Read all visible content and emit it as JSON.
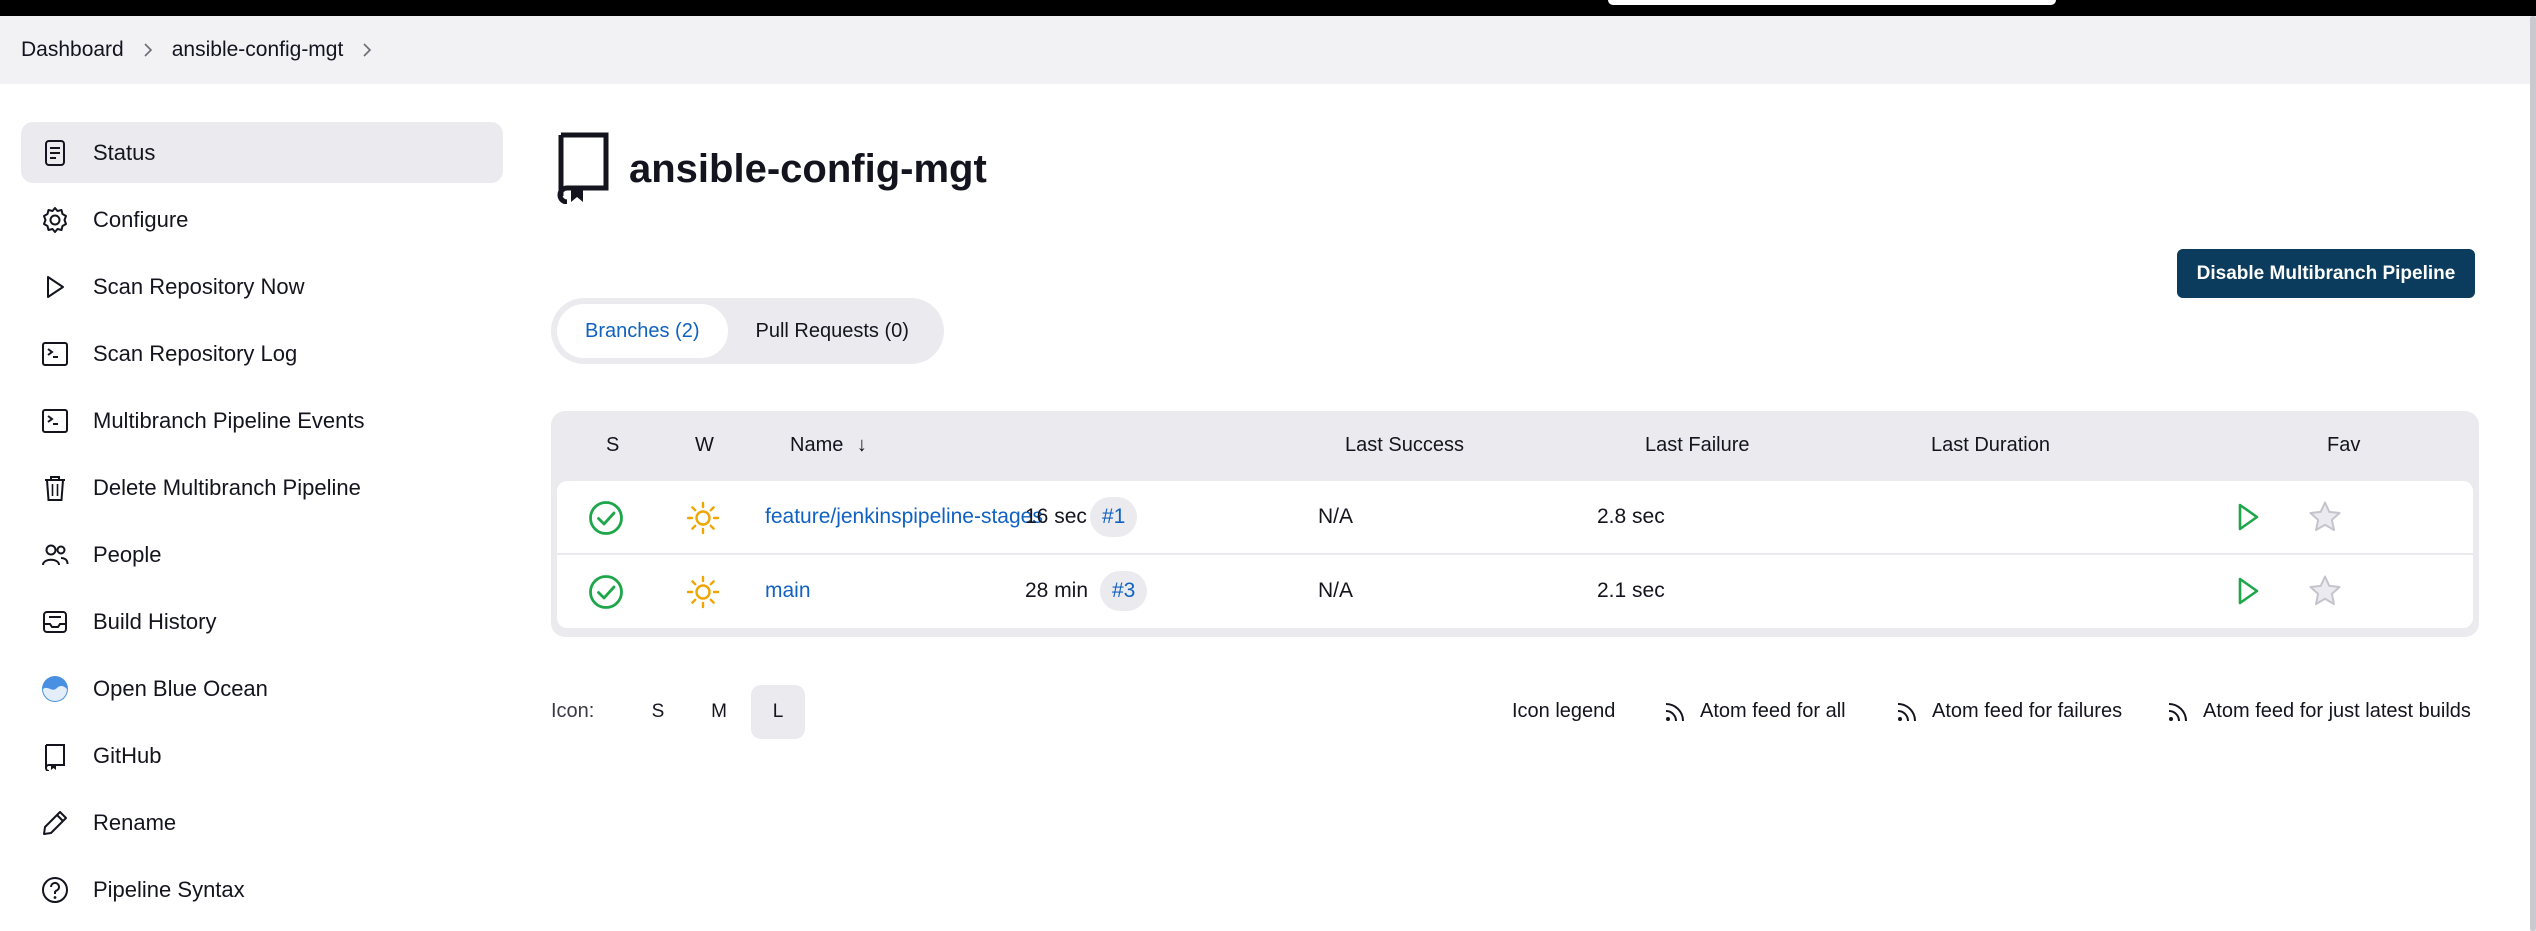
{
  "breadcrumb": {
    "items": [
      {
        "label": "Dashboard"
      },
      {
        "label": "ansible-config-mgt"
      }
    ]
  },
  "sidebar": {
    "items": [
      {
        "label": "Status",
        "icon": "status-document-icon",
        "active": true
      },
      {
        "label": "Configure",
        "icon": "gear-icon"
      },
      {
        "label": "Scan Repository Now",
        "icon": "play-icon"
      },
      {
        "label": "Scan Repository Log",
        "icon": "terminal-icon"
      },
      {
        "label": "Multibranch Pipeline Events",
        "icon": "terminal-icon"
      },
      {
        "label": "Delete Multibranch Pipeline",
        "icon": "trash-icon"
      },
      {
        "label": "People",
        "icon": "people-icon"
      },
      {
        "label": "Build History",
        "icon": "inbox-icon"
      },
      {
        "label": "Open Blue Ocean",
        "icon": "blue-ocean-icon"
      },
      {
        "label": "GitHub",
        "icon": "repository-icon"
      },
      {
        "label": "Rename",
        "icon": "pencil-icon"
      },
      {
        "label": "Pipeline Syntax",
        "icon": "help-circle-icon"
      }
    ]
  },
  "page": {
    "title": "ansible-config-mgt",
    "title_icon": "repository-icon",
    "disable_button": "Disable Multibranch Pipeline"
  },
  "tabs": [
    {
      "label": "Branches (2)",
      "active": true
    },
    {
      "label": "Pull Requests (0)",
      "active": false
    }
  ],
  "table": {
    "headers": {
      "s": "S",
      "w": "W",
      "name": "Name",
      "sort_indicator": "↓",
      "last_success": "Last Success",
      "last_failure": "Last Failure",
      "last_duration": "Last Duration",
      "fav": "Fav"
    },
    "rows": [
      {
        "status": "success",
        "weather": "sunny",
        "name": "feature/jenkinspipeline-stages",
        "last_success": "16 sec",
        "build": "#1",
        "last_failure": "N/A",
        "last_duration": "2.8 sec"
      },
      {
        "status": "success",
        "weather": "sunny",
        "name": "main",
        "last_success": "28 min",
        "build": "#3",
        "last_failure": "N/A",
        "last_duration": "2.1 sec"
      }
    ]
  },
  "footer": {
    "icon_label": "Icon:",
    "sizes": [
      {
        "label": "S",
        "active": false
      },
      {
        "label": "M",
        "active": false
      },
      {
        "label": "L",
        "active": true
      }
    ],
    "icon_legend": "Icon legend",
    "feeds": [
      {
        "label": "Atom feed for all",
        "icon": "rss-icon"
      },
      {
        "label": "Atom feed for failures",
        "icon": "rss-icon"
      },
      {
        "label": "Atom feed for just latest builds",
        "icon": "rss-icon"
      }
    ]
  },
  "colors": {
    "link": "#1062c2",
    "primary_button": "#0b3c5d",
    "success": "#1ea64b",
    "sunny": "#f0a500",
    "surface": "#ebebef"
  }
}
